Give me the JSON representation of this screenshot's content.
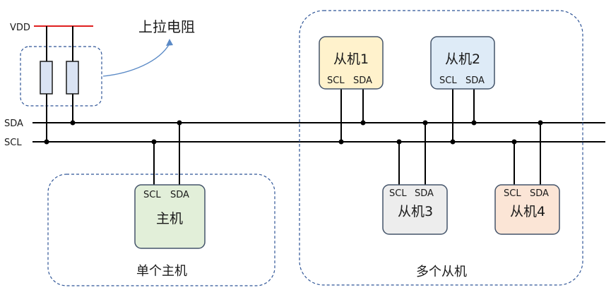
{
  "power": {
    "vdd_label": "VDD",
    "vdd_color": "#e02020"
  },
  "pullup": {
    "label": "上拉电阻"
  },
  "bus": {
    "sda_label": "SDA",
    "scl_label": "SCL"
  },
  "master": {
    "scl_label": "SCL",
    "sda_label": "SDA",
    "name": "主机",
    "name_color": "#e02020",
    "fill": "#e2efd9",
    "group_label": "单个主机"
  },
  "slaves": [
    {
      "name": "从机1",
      "scl_label": "SCL",
      "sda_label": "SDA",
      "fill": "#fff2cc"
    },
    {
      "name": "从机2",
      "scl_label": "SCL",
      "sda_label": "SDA",
      "fill": "#deebf7"
    },
    {
      "name": "从机3",
      "scl_label": "SCL",
      "sda_label": "SDA",
      "fill": "#ededed"
    },
    {
      "name": "从机4",
      "scl_label": "SCL",
      "sda_label": "SDA",
      "fill": "#fbe5d6"
    }
  ],
  "slave_group_label": "多个从机",
  "colors": {
    "line": "#000000",
    "dashed_border": "#2f5597",
    "box_border": "#44546a",
    "resistor_fill": "#dae3f3",
    "arrow": "#5b8ac6"
  }
}
